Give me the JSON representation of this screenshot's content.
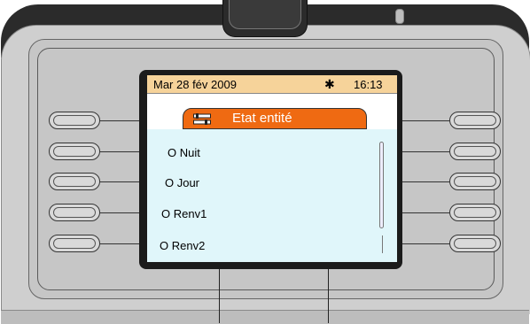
{
  "status": {
    "date": "Mar 28 fév 2009",
    "time": "16:13",
    "network_symbol": "✱"
  },
  "title": "Etat entité",
  "title_icon": "tools-icon",
  "menu": {
    "items": [
      {
        "label": "O Nuit"
      },
      {
        "label": "O Jour"
      },
      {
        "label": "O Renv1"
      },
      {
        "label": "O Renv2"
      }
    ]
  },
  "colors": {
    "title_bar": "#ef6a12",
    "status_bar": "#f6d39a",
    "list_background": "#e0f6fa"
  }
}
